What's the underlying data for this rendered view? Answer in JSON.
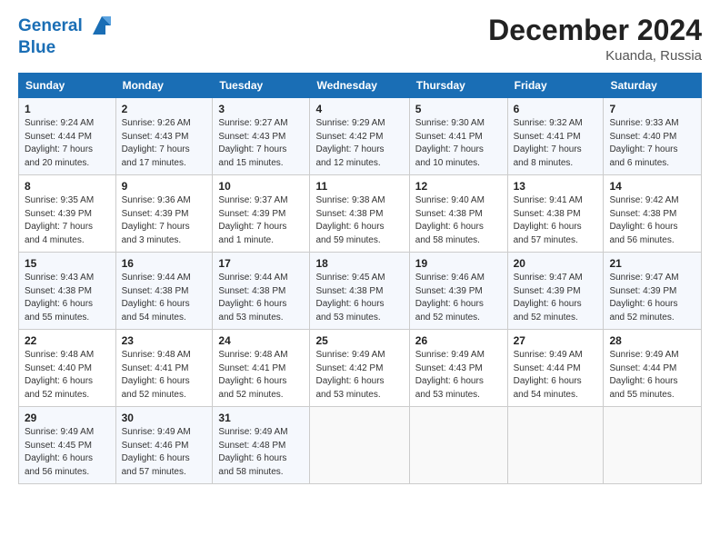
{
  "header": {
    "logo_line1": "General",
    "logo_line2": "Blue",
    "month": "December 2024",
    "location": "Kuanda, Russia"
  },
  "weekdays": [
    "Sunday",
    "Monday",
    "Tuesday",
    "Wednesday",
    "Thursday",
    "Friday",
    "Saturday"
  ],
  "weeks": [
    [
      {
        "day": "1",
        "info": "Sunrise: 9:24 AM\nSunset: 4:44 PM\nDaylight: 7 hours\nand 20 minutes."
      },
      {
        "day": "2",
        "info": "Sunrise: 9:26 AM\nSunset: 4:43 PM\nDaylight: 7 hours\nand 17 minutes."
      },
      {
        "day": "3",
        "info": "Sunrise: 9:27 AM\nSunset: 4:43 PM\nDaylight: 7 hours\nand 15 minutes."
      },
      {
        "day": "4",
        "info": "Sunrise: 9:29 AM\nSunset: 4:42 PM\nDaylight: 7 hours\nand 12 minutes."
      },
      {
        "day": "5",
        "info": "Sunrise: 9:30 AM\nSunset: 4:41 PM\nDaylight: 7 hours\nand 10 minutes."
      },
      {
        "day": "6",
        "info": "Sunrise: 9:32 AM\nSunset: 4:41 PM\nDaylight: 7 hours\nand 8 minutes."
      },
      {
        "day": "7",
        "info": "Sunrise: 9:33 AM\nSunset: 4:40 PM\nDaylight: 7 hours\nand 6 minutes."
      }
    ],
    [
      {
        "day": "8",
        "info": "Sunrise: 9:35 AM\nSunset: 4:39 PM\nDaylight: 7 hours\nand 4 minutes."
      },
      {
        "day": "9",
        "info": "Sunrise: 9:36 AM\nSunset: 4:39 PM\nDaylight: 7 hours\nand 3 minutes."
      },
      {
        "day": "10",
        "info": "Sunrise: 9:37 AM\nSunset: 4:39 PM\nDaylight: 7 hours\nand 1 minute."
      },
      {
        "day": "11",
        "info": "Sunrise: 9:38 AM\nSunset: 4:38 PM\nDaylight: 6 hours\nand 59 minutes."
      },
      {
        "day": "12",
        "info": "Sunrise: 9:40 AM\nSunset: 4:38 PM\nDaylight: 6 hours\nand 58 minutes."
      },
      {
        "day": "13",
        "info": "Sunrise: 9:41 AM\nSunset: 4:38 PM\nDaylight: 6 hours\nand 57 minutes."
      },
      {
        "day": "14",
        "info": "Sunrise: 9:42 AM\nSunset: 4:38 PM\nDaylight: 6 hours\nand 56 minutes."
      }
    ],
    [
      {
        "day": "15",
        "info": "Sunrise: 9:43 AM\nSunset: 4:38 PM\nDaylight: 6 hours\nand 55 minutes."
      },
      {
        "day": "16",
        "info": "Sunrise: 9:44 AM\nSunset: 4:38 PM\nDaylight: 6 hours\nand 54 minutes."
      },
      {
        "day": "17",
        "info": "Sunrise: 9:44 AM\nSunset: 4:38 PM\nDaylight: 6 hours\nand 53 minutes."
      },
      {
        "day": "18",
        "info": "Sunrise: 9:45 AM\nSunset: 4:38 PM\nDaylight: 6 hours\nand 53 minutes."
      },
      {
        "day": "19",
        "info": "Sunrise: 9:46 AM\nSunset: 4:39 PM\nDaylight: 6 hours\nand 52 minutes."
      },
      {
        "day": "20",
        "info": "Sunrise: 9:47 AM\nSunset: 4:39 PM\nDaylight: 6 hours\nand 52 minutes."
      },
      {
        "day": "21",
        "info": "Sunrise: 9:47 AM\nSunset: 4:39 PM\nDaylight: 6 hours\nand 52 minutes."
      }
    ],
    [
      {
        "day": "22",
        "info": "Sunrise: 9:48 AM\nSunset: 4:40 PM\nDaylight: 6 hours\nand 52 minutes."
      },
      {
        "day": "23",
        "info": "Sunrise: 9:48 AM\nSunset: 4:41 PM\nDaylight: 6 hours\nand 52 minutes."
      },
      {
        "day": "24",
        "info": "Sunrise: 9:48 AM\nSunset: 4:41 PM\nDaylight: 6 hours\nand 52 minutes."
      },
      {
        "day": "25",
        "info": "Sunrise: 9:49 AM\nSunset: 4:42 PM\nDaylight: 6 hours\nand 53 minutes."
      },
      {
        "day": "26",
        "info": "Sunrise: 9:49 AM\nSunset: 4:43 PM\nDaylight: 6 hours\nand 53 minutes."
      },
      {
        "day": "27",
        "info": "Sunrise: 9:49 AM\nSunset: 4:44 PM\nDaylight: 6 hours\nand 54 minutes."
      },
      {
        "day": "28",
        "info": "Sunrise: 9:49 AM\nSunset: 4:44 PM\nDaylight: 6 hours\nand 55 minutes."
      }
    ],
    [
      {
        "day": "29",
        "info": "Sunrise: 9:49 AM\nSunset: 4:45 PM\nDaylight: 6 hours\nand 56 minutes."
      },
      {
        "day": "30",
        "info": "Sunrise: 9:49 AM\nSunset: 4:46 PM\nDaylight: 6 hours\nand 57 minutes."
      },
      {
        "day": "31",
        "info": "Sunrise: 9:49 AM\nSunset: 4:48 PM\nDaylight: 6 hours\nand 58 minutes."
      },
      null,
      null,
      null,
      null
    ]
  ]
}
